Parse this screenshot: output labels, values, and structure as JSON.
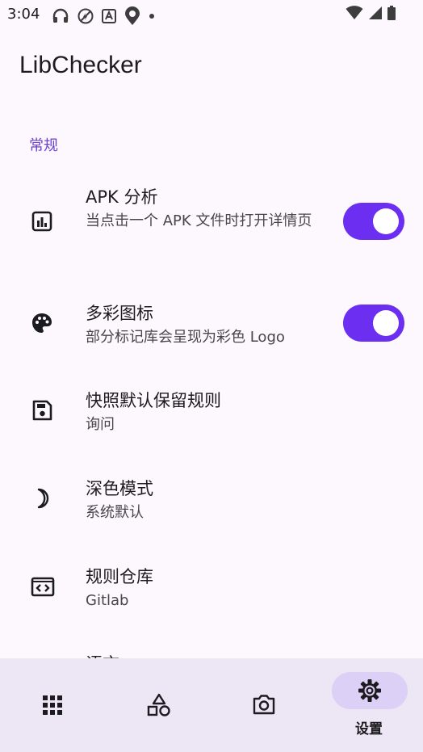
{
  "status_bar": {
    "time": "3:04"
  },
  "app": {
    "title": "LibChecker"
  },
  "section": {
    "general": "常规"
  },
  "settings": [
    {
      "title": "APK 分析",
      "summary": "当点击一个 APK 文件时打开详情页",
      "icon": "bar-chart-doc-icon",
      "toggle": true
    },
    {
      "title": "多彩图标",
      "summary": "部分标记库会呈现为彩色 Logo",
      "icon": "palette-icon",
      "toggle": true
    },
    {
      "title": "快照默认保留规则",
      "summary": "询问",
      "icon": "save-icon",
      "toggle": null
    },
    {
      "title": "深色模式",
      "summary": "系统默认",
      "icon": "moon-icon",
      "toggle": null
    },
    {
      "title": "规则仓库",
      "summary": "Gitlab",
      "icon": "code-window-icon",
      "toggle": null
    },
    {
      "title": "语言",
      "summary": "",
      "icon": "language-icon",
      "toggle": null
    }
  ],
  "nav": {
    "items": [
      "apps-grid-icon",
      "shapes-icon",
      "camera-icon",
      "gear-icon"
    ],
    "selected_label": "设置"
  },
  "colors": {
    "accent": "#6c2ff2",
    "section": "#6b3fd4",
    "nav_bg": "#ede6f4",
    "indicator": "#ddd0f7"
  }
}
